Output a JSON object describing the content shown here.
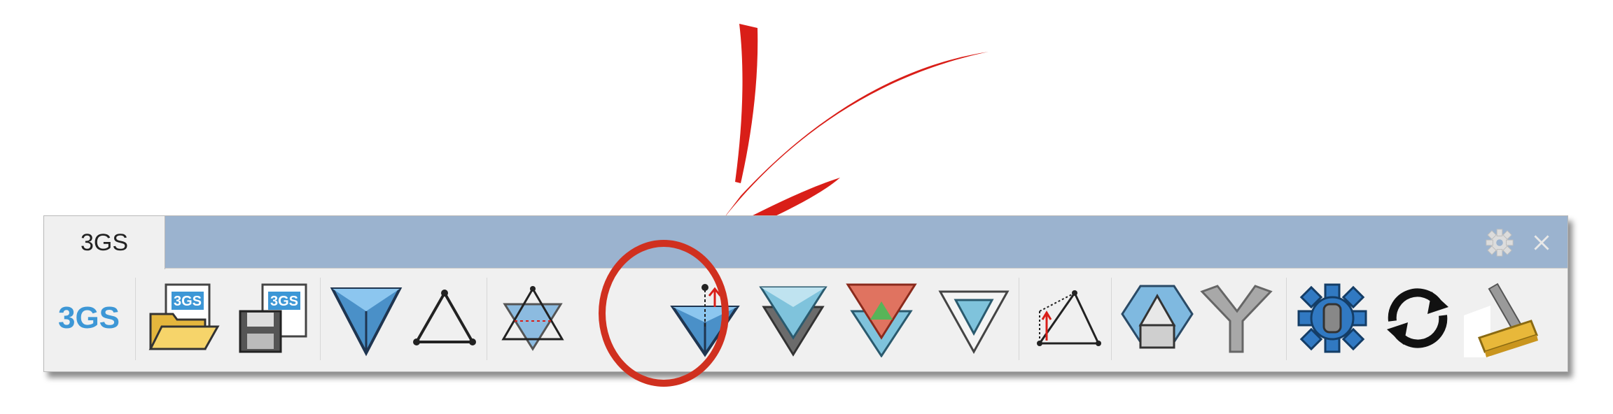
{
  "tab": {
    "label": "3GS"
  },
  "controls": {
    "settings": "gear-icon",
    "close": "close-icon"
  },
  "tools": [
    {
      "name": "3gs-logo",
      "text": "3GS"
    },
    {
      "name": "open-file-button",
      "icon": "open-folder-icon",
      "text": "3GS"
    },
    {
      "name": "save-file-button",
      "icon": "floppy-save-icon",
      "text": "3GS"
    },
    {
      "name": "form-diagram-button",
      "icon": "blue-triangle-icon"
    },
    {
      "name": "force-diagram-button",
      "icon": "outline-triangle-icon"
    },
    {
      "name": "edit-diagram-button",
      "icon": "crossed-triangle-icon"
    },
    {
      "name": "modify-vertex-button",
      "icon": "triangle-vertex-move-icon"
    },
    {
      "name": "duplicate-diagram-button",
      "icon": "stacked-triangle-icon"
    },
    {
      "name": "dual-diagram-button",
      "icon": "red-green-triangle-icon"
    },
    {
      "name": "inner-triangle-button",
      "icon": "nested-triangle-icon"
    },
    {
      "name": "dimension-button",
      "icon": "triangle-dimension-icon"
    },
    {
      "name": "polyhedron-button",
      "icon": "hexagon-prism-icon"
    },
    {
      "name": "node-connector-button",
      "icon": "y-connector-icon"
    },
    {
      "name": "settings-gear-button",
      "icon": "blue-gear-icon"
    },
    {
      "name": "refresh-button",
      "icon": "refresh-arrows-icon"
    },
    {
      "name": "clear-button",
      "icon": "broom-icon"
    }
  ],
  "colors": {
    "tab_strip": "#9bb3cf",
    "panel": "#f0f0f0",
    "accent_blue": "#3d97d6",
    "annotation_red": "#d91e18"
  }
}
